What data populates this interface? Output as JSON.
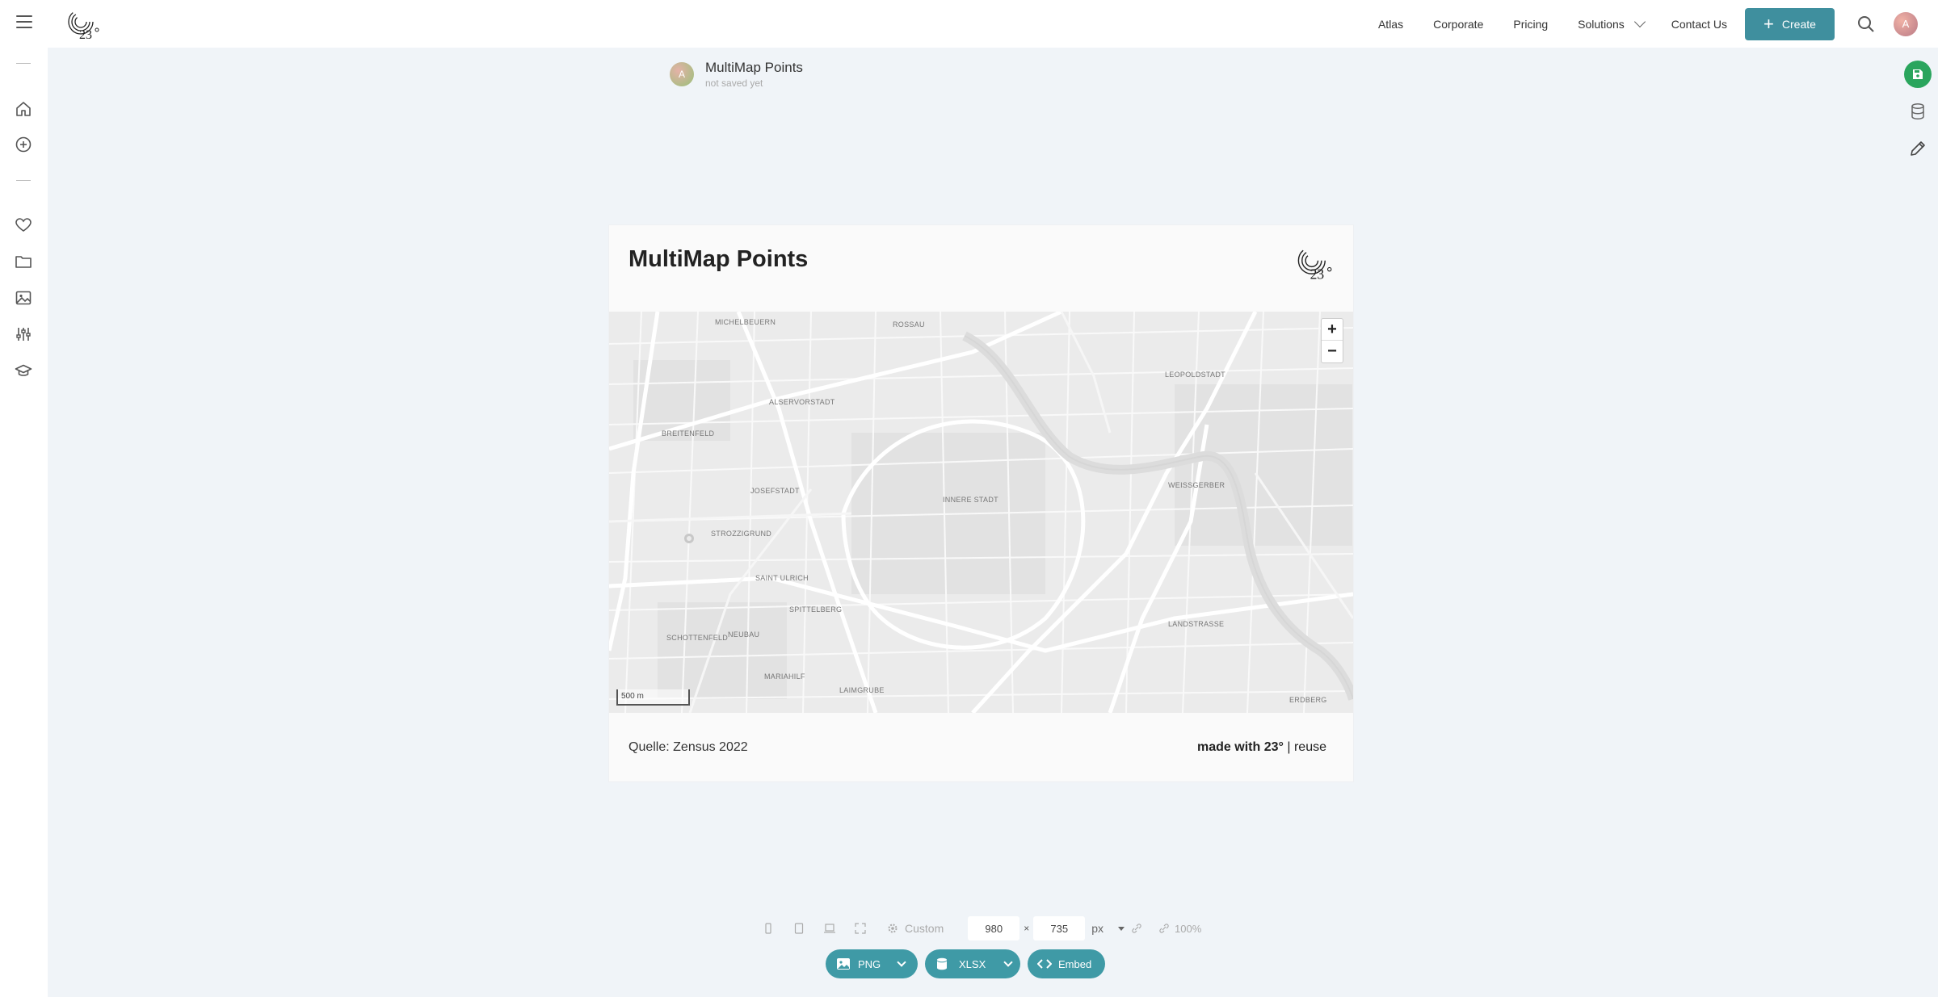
{
  "header": {
    "nav": [
      "Atlas",
      "Corporate",
      "Pricing"
    ],
    "solutions_label": "Solutions",
    "contact_label": "Contact Us",
    "create_label": "Create",
    "avatar_initial": "A"
  },
  "document": {
    "avatar_initial": "A",
    "title": "MultiMap Points",
    "status": "not saved yet"
  },
  "card": {
    "title": "MultiMap Points",
    "source": "Quelle: Zensus 2022",
    "made_with": "made with 23°",
    "separator": "|",
    "reuse": "reuse"
  },
  "map": {
    "zoom_in": "+",
    "zoom_out": "−",
    "scale_label": "500 m",
    "labels": {
      "michelbeuern": "MICHELBEUERN",
      "rossau": "ROSSAU",
      "leopoldstadt": "LEOPOLDSTADT",
      "alservorstadt": "ALSERVORSTADT",
      "breitenfeld": "BREITENFELD",
      "josefstadt": "JOSEFSTADT",
      "innere_stadt": "INNERE STADT",
      "weissgerber": "WEISSGERBER",
      "strozzigrund": "STROZZIGRUND",
      "saint_ulrich": "SAINT ULRICH",
      "spittelberg": "SPITTELBERG",
      "schottenfeld": "SCHOTTENFELD",
      "neubau": "NEUBAU",
      "landstrasse": "LANDSTRASSE",
      "mariahilf": "MARIAHILF",
      "laimgrube": "LAIMGRUBE",
      "erdberg": "ERDBERG"
    }
  },
  "toolbar": {
    "size_preset": "Custom",
    "width": "980",
    "height": "735",
    "times": "×",
    "unit": "px",
    "zoom": "100%",
    "png_label": "PNG",
    "xlsx_label": "XLSX",
    "embed_label": "Embed"
  },
  "colors": {
    "accent": "#3f8f9e",
    "export": "#3f9aa6",
    "save": "#2aa55d",
    "background": "#f0f4f8"
  }
}
